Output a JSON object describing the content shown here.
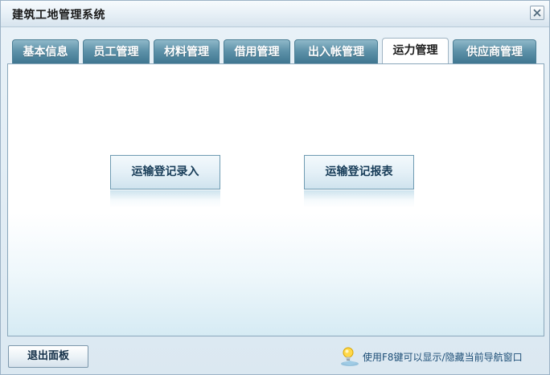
{
  "window": {
    "title": "建筑工地管理系统"
  },
  "tabs": [
    {
      "label": "基本信息",
      "active": false
    },
    {
      "label": "员工管理",
      "active": false
    },
    {
      "label": "材料管理",
      "active": false
    },
    {
      "label": "借用管理",
      "active": false
    },
    {
      "label": "出入帐管理",
      "active": false
    },
    {
      "label": "运力管理",
      "active": true
    },
    {
      "label": "供应商管理",
      "active": false
    }
  ],
  "panel": {
    "buttons": [
      {
        "label": "运输登记录入"
      },
      {
        "label": "运输登记报表"
      }
    ]
  },
  "footer": {
    "exit_label": "退出面板",
    "hint_text": "使用F8键可以显示/隐藏当前导航窗口"
  },
  "icons": {
    "close": "close-icon",
    "hint": "lightbulb-icon"
  },
  "colors": {
    "tab_inactive": "#5f93aa",
    "tab_active": "#ffffff",
    "hint_text": "#1d4e77"
  }
}
